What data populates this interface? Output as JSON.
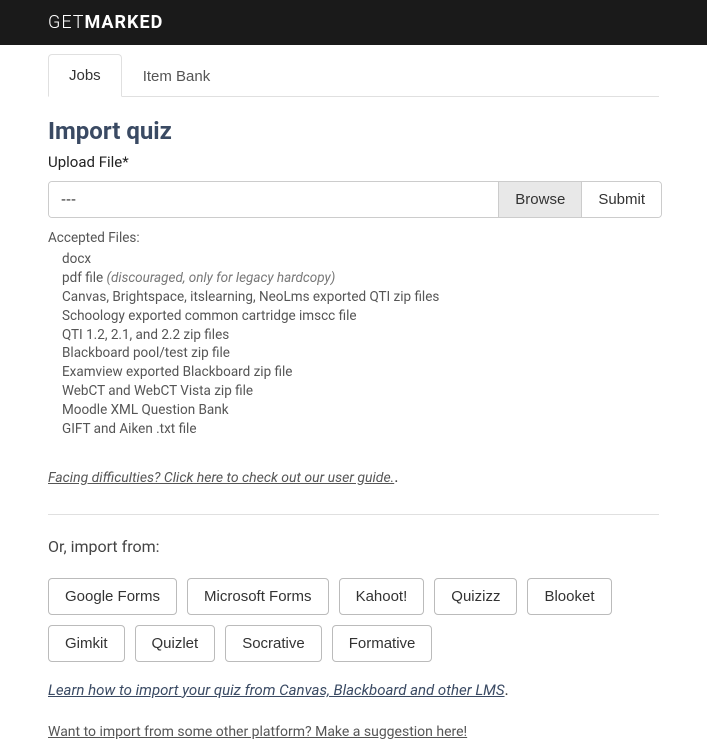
{
  "header": {
    "logo_thin": "GET",
    "logo_bold": "MARKED"
  },
  "tabs": {
    "jobs": "Jobs",
    "item_bank": "Item Bank"
  },
  "main": {
    "title": "Import quiz",
    "upload_label": "Upload File*",
    "file_value": "---",
    "browse_label": "Browse",
    "submit_label": "Submit",
    "accepted_label": "Accepted Files:",
    "accepted_files": [
      {
        "text": "docx",
        "italic_suffix": ""
      },
      {
        "text": "pdf file ",
        "italic_suffix": "(discouraged, only for legacy hardcopy)"
      },
      {
        "text": "Canvas, Brightspace, itslearning, NeoLms exported QTI zip files",
        "italic_suffix": ""
      },
      {
        "text": "Schoology exported common cartridge imscc file",
        "italic_suffix": ""
      },
      {
        "text": "QTI 1.2, 2.1, and 2.2 zip files",
        "italic_suffix": ""
      },
      {
        "text": "Blackboard pool/test zip file",
        "italic_suffix": ""
      },
      {
        "text": "Examview exported Blackboard zip file",
        "italic_suffix": ""
      },
      {
        "text": "WebCT and WebCT Vista zip file",
        "italic_suffix": ""
      },
      {
        "text": "Moodle XML Question Bank",
        "italic_suffix": ""
      },
      {
        "text": "GIFT and Aiken .txt file",
        "italic_suffix": ""
      }
    ],
    "help_link": "Facing difficulties? Click here to check out our user guide.",
    "or_import_label": "Or, import from:",
    "import_sources": [
      "Google Forms",
      "Microsoft Forms",
      "Kahoot!",
      "Quizizz",
      "Blooket",
      "Gimkit",
      "Quizlet",
      "Socrative",
      "Formative"
    ],
    "learn_link": "Learn how to import your quiz from Canvas, Blackboard and other LMS",
    "suggest_link": "Want to import from some other platform? Make a suggestion here!"
  }
}
